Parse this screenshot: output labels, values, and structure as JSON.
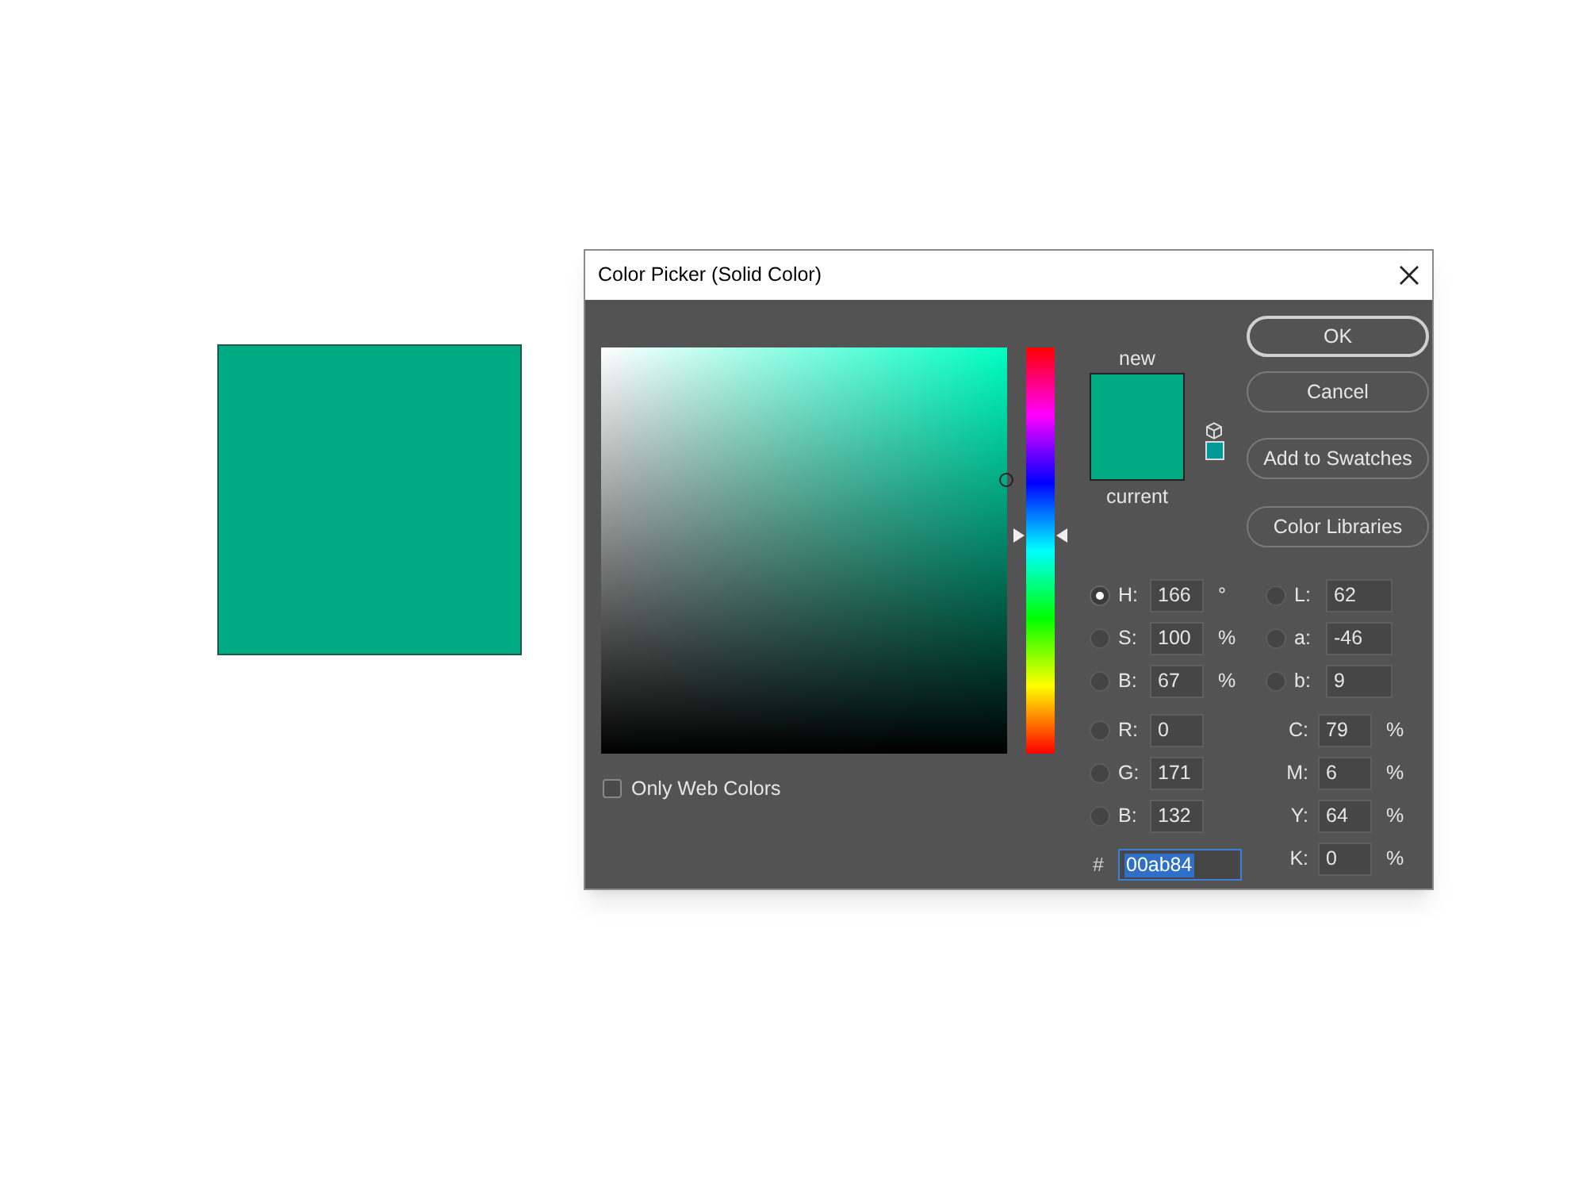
{
  "window": {
    "title": "Color Picker (Solid Color)"
  },
  "hue_slider": {
    "level": 0.539
  },
  "preview": {
    "new_label": "new",
    "current_label": "current"
  },
  "buttons": [
    {
      "label": "OK",
      "default": true
    },
    {
      "label": "Cancel",
      "default": false
    },
    {
      "label": "Add to Swatches",
      "default": false
    },
    {
      "label": "Color Libraries",
      "default": false
    }
  ],
  "only_web_colors": {
    "label": "Only Web Colors",
    "checked": false
  },
  "left_fields": [
    {
      "label": "H:",
      "value": "166",
      "unit": "°",
      "selected": true
    },
    {
      "label": "S:",
      "value": "100",
      "unit": "%",
      "selected": false
    },
    {
      "label": "B:",
      "value": "67",
      "unit": "%",
      "selected": false
    },
    {
      "label": "R:",
      "value": "0",
      "selected": false
    },
    {
      "label": "G:",
      "value": "171",
      "selected": false
    },
    {
      "label": "B:",
      "value": "132",
      "selected": false
    }
  ],
  "lab_fields": [
    {
      "label": "L:",
      "value": "62",
      "selected": false
    },
    {
      "label": "a:",
      "value": "-46",
      "selected": false
    },
    {
      "label": "b:",
      "value": "9",
      "selected": false
    }
  ],
  "cmyk_fields": [
    {
      "label": "C:",
      "value": "79",
      "unit": "%"
    },
    {
      "label": "M:",
      "value": "6",
      "unit": "%"
    },
    {
      "label": "Y:",
      "value": "64",
      "unit": "%"
    },
    {
      "label": "K:",
      "value": "0",
      "unit": "%"
    }
  ],
  "hex": {
    "label": "#",
    "value": "00ab84"
  }
}
